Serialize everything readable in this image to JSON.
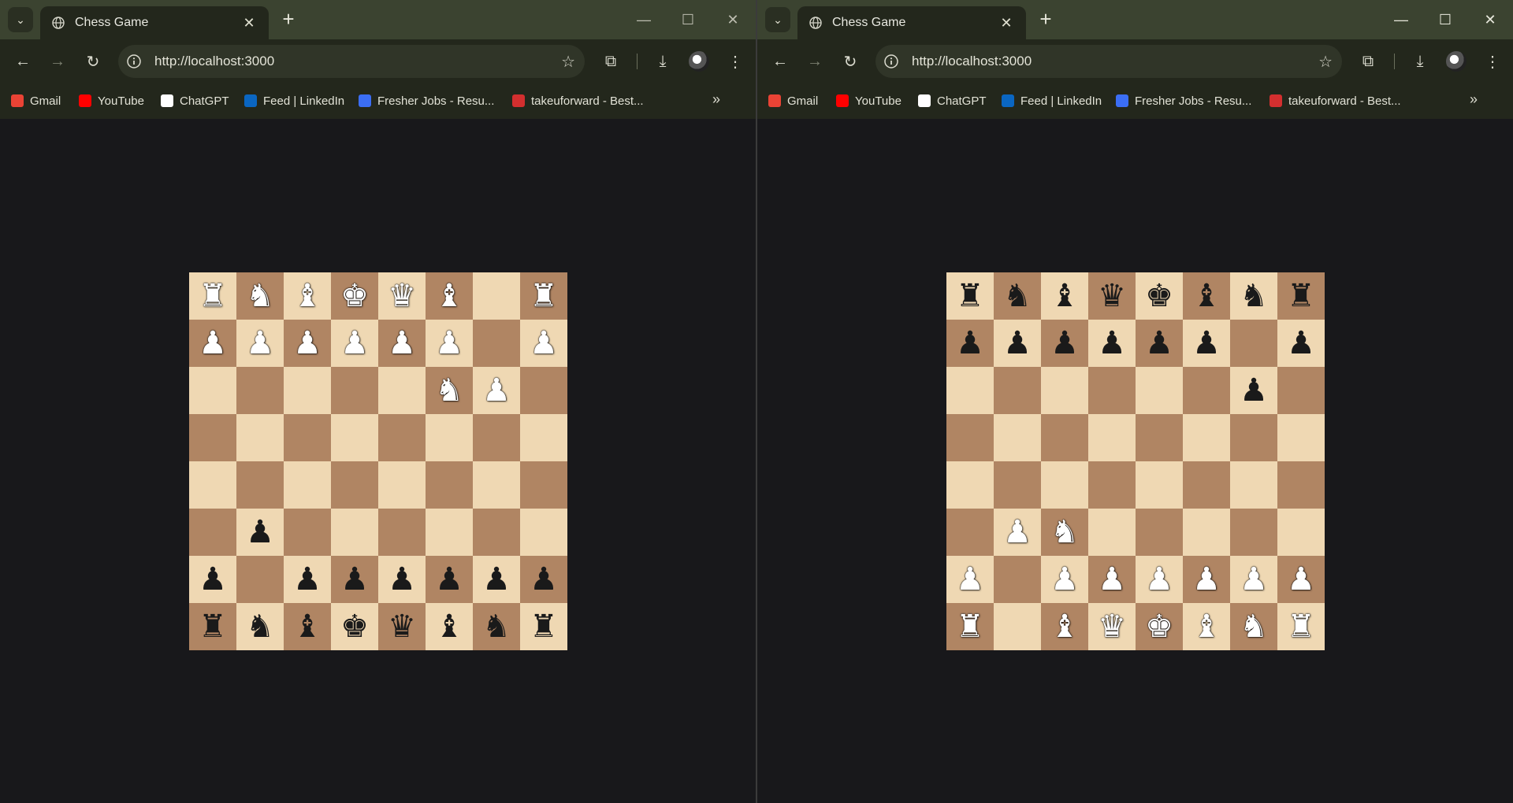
{
  "browser": {
    "tab_title": "Chess Game",
    "url": "http://localhost:3000",
    "bookmarks": [
      {
        "label": "Gmail",
        "icon": "gmail-icon",
        "color": "#ea4335"
      },
      {
        "label": "YouTube",
        "icon": "youtube-icon",
        "color": "#ff0000"
      },
      {
        "label": "ChatGPT",
        "icon": "chatgpt-icon",
        "color": "#ffffff"
      },
      {
        "label": "Feed | LinkedIn",
        "icon": "linkedin-icon",
        "color": "#0a66c2"
      },
      {
        "label": "Fresher Jobs - Resu...",
        "icon": "fresher-jobs-icon",
        "color": "#3b6ef5"
      },
      {
        "label": "takeuforward - Best...",
        "icon": "takeuforward-icon",
        "color": "#d32f2f"
      }
    ]
  },
  "board_colors": {
    "light": "#efd8b3",
    "dark": "#b08563"
  },
  "pieces": {
    "R": "♜",
    "N": "♞",
    "B": "♝",
    "Q": "♛",
    "K": "♚",
    "P": "♟",
    "r": "♜",
    "n": "♞",
    "b": "♝",
    "q": "♛",
    "k": "♚",
    "p": "♟"
  },
  "windows": [
    {
      "id": "left",
      "rows": [
        "RNBKQB.R",
        "PPPPPP.P",
        ".....NP.",
        "........",
        "........",
        ".p......",
        "p.pppppp",
        "rnbkqbnr"
      ]
    },
    {
      "id": "right",
      "rows": [
        "rnbqkbnr",
        "pppppp.p",
        "......p.",
        "........",
        "........",
        ".PN.....",
        "P.PPPPPP",
        "R.BQKBNR"
      ]
    }
  ]
}
